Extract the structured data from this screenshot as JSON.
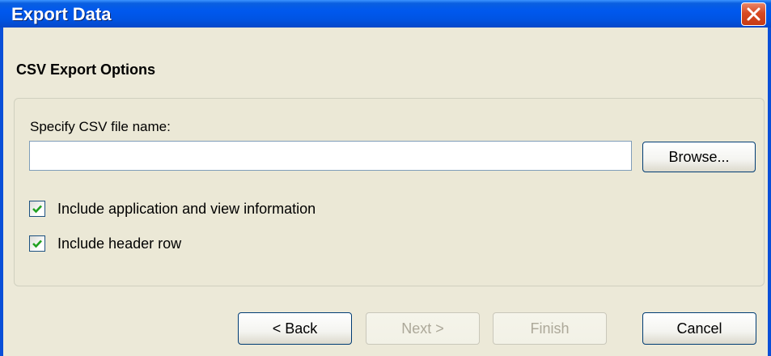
{
  "window": {
    "title": "Export Data"
  },
  "page": {
    "section_title": "CSV Export Options"
  },
  "file": {
    "label": "Specify CSV file name:",
    "value": "",
    "placeholder": "",
    "browse_label": "Browse..."
  },
  "options": {
    "include_app_info": {
      "label": "Include application and view information",
      "checked": true
    },
    "include_header": {
      "label": "Include header row",
      "checked": true
    }
  },
  "buttons": {
    "back": {
      "label": "< Back",
      "enabled": true
    },
    "next": {
      "label": "Next >",
      "enabled": false
    },
    "finish": {
      "label": "Finish",
      "enabled": false
    },
    "cancel": {
      "label": "Cancel",
      "enabled": true
    }
  },
  "icons": {
    "close": "close-icon",
    "check": "checkmark-icon"
  },
  "colors": {
    "titlebar": "#0054E3",
    "window_bg": "#ECE9D8",
    "close_button": "#D84A22",
    "check": "#21A121"
  }
}
